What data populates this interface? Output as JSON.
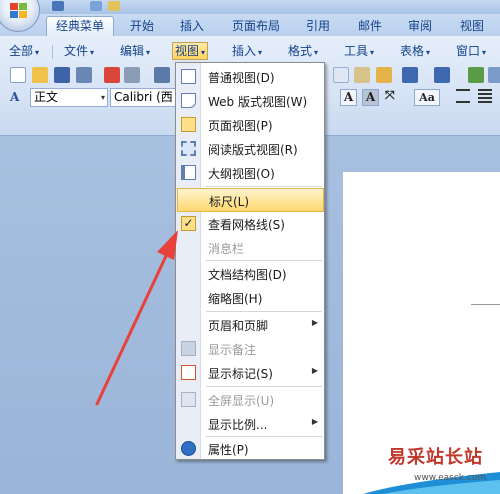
{
  "tabs": [
    "经典菜单",
    "开始",
    "插入",
    "页面布局",
    "引用",
    "邮件",
    "审阅",
    "视图"
  ],
  "menubar": [
    "全部",
    "文件",
    "编辑",
    "视图",
    "插入",
    "格式",
    "工具",
    "表格",
    "窗口"
  ],
  "format_bar": {
    "style": "正文",
    "font": "Calibri (西文"
  },
  "view_menu": {
    "items": [
      {
        "label": "普通视图(D)",
        "icon": "normal-view-icon",
        "enabled": true
      },
      {
        "label": "Web 版式视图(W)",
        "icon": "web-layout-icon",
        "enabled": true
      },
      {
        "label": "页面视图(P)",
        "icon": "page-view-icon",
        "enabled": true
      },
      {
        "label": "阅读版式视图(R)",
        "icon": "reading-layout-icon",
        "enabled": true
      },
      {
        "label": "大纲视图(O)",
        "icon": "outline-view-icon",
        "enabled": true
      },
      {
        "label": "标尺(L)",
        "icon": "",
        "enabled": true,
        "highlighted": true
      },
      {
        "label": "查看网格线(S)",
        "icon": "checkmark-icon",
        "enabled": true,
        "checked": true
      },
      {
        "label": "消息栏",
        "icon": "",
        "enabled": false
      },
      {
        "label": "文档结构图(D)",
        "icon": "",
        "enabled": true
      },
      {
        "label": "缩略图(H)",
        "icon": "",
        "enabled": true
      },
      {
        "label": "页眉和页脚",
        "icon": "",
        "enabled": true,
        "submenu": true
      },
      {
        "label": "显示备注",
        "icon": "comments-icon",
        "enabled": false
      },
      {
        "label": "显示标记(S)",
        "icon": "markup-icon",
        "enabled": true,
        "submenu": true
      },
      {
        "label": "全屏显示(U)",
        "icon": "fullscreen-icon",
        "enabled": false
      },
      {
        "label": "显示比例...",
        "icon": "",
        "enabled": true,
        "submenu": true
      },
      {
        "label": "属性(P)",
        "icon": "properties-icon",
        "enabled": true
      }
    ]
  },
  "watermark": {
    "title": "易采站长站",
    "url": "www.easck.com"
  },
  "colors": {
    "highlight": "#ffd870",
    "accent": "#15428b",
    "arrow": "#e8413a"
  }
}
